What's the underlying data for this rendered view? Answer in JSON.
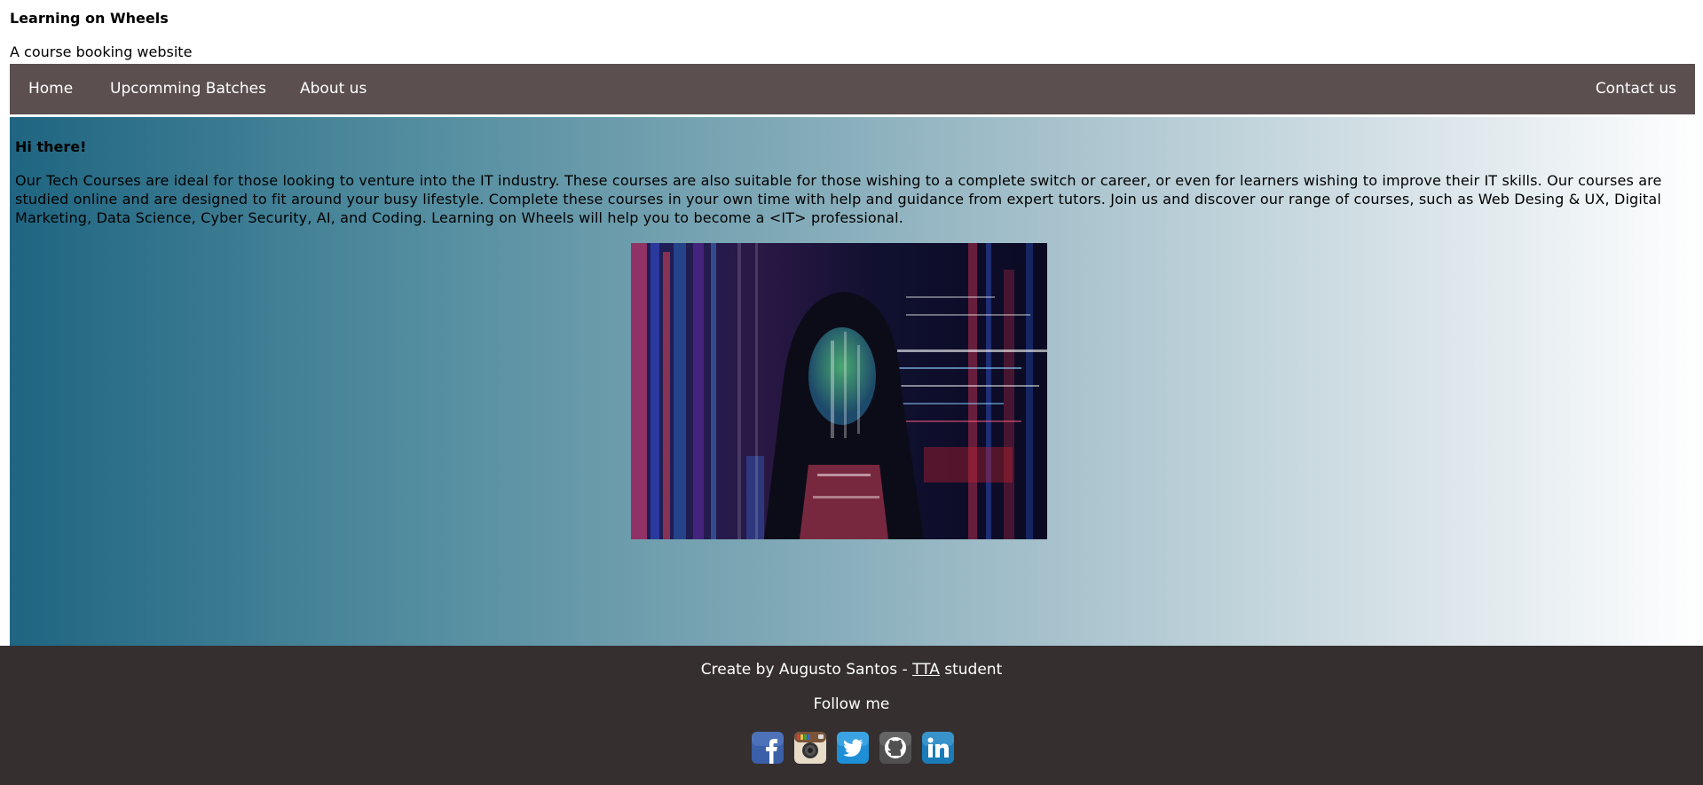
{
  "header": {
    "title": "Learning on Wheels",
    "subtitle": "A course booking website"
  },
  "nav": {
    "home": "Home",
    "batches": "Upcomming Batches",
    "about": "About us",
    "contact": "Contact us",
    "background": "#5c4f50"
  },
  "main": {
    "greeting": "Hi there!",
    "intro": "Our Tech Courses are ideal for those looking to venture into the IT industry. These courses are also suitable for those wishing to a complete switch or career, or even for learners wishing to improve their IT skills. Our courses are studied online and are designed to fit around your busy lifestyle. Complete these courses in your own time with help and guidance from expert tutors. Join us and discover our range of courses, such as Web Desing & UX, Digital Marketing, Data Science, Cyber Security, AI, and Coding. Learning on Wheels will help you to become a <IT> professional.",
    "image_icon": "hooded-person-code-projection-image"
  },
  "footer": {
    "credit_prefix": "Create by Augusto Santos - ",
    "credit_link": "TTA",
    "credit_suffix": " student",
    "follow": "Follow me",
    "socials": [
      {
        "icon": "facebook-icon"
      },
      {
        "icon": "instagram-icon"
      },
      {
        "icon": "twitter-icon"
      },
      {
        "icon": "github-icon"
      },
      {
        "icon": "linkedin-icon"
      }
    ],
    "background": "#352f2f"
  }
}
